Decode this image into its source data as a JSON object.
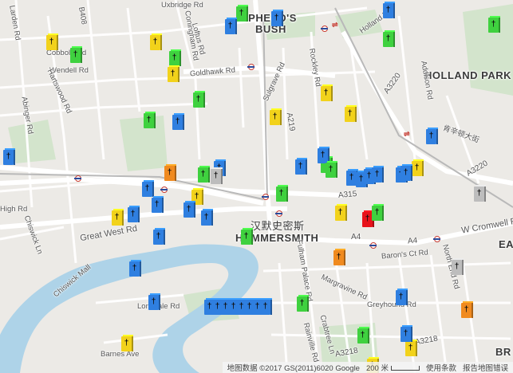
{
  "map": {
    "areas": [
      {
        "text": "EPHERD'S",
        "key": "shep1"
      },
      {
        "text": "BUSH",
        "key": "shep2"
      },
      {
        "text": "HOLLAND PARK",
        "key": "holland"
      },
      {
        "text": "HAMMERSMITH",
        "key": "hammer"
      },
      {
        "text": "汉默史密斯",
        "key": "hammer_cn"
      },
      {
        "text": "EA",
        "key": "ea"
      },
      {
        "text": "BR",
        "key": "br"
      }
    ],
    "roads": [
      {
        "text": "Uxbridge Rd",
        "key": "uxb"
      },
      {
        "text": "B408",
        "key": "b408"
      },
      {
        "text": "Larden Rd",
        "key": "larden"
      },
      {
        "text": "Cobbold Rd",
        "key": "cobbold"
      },
      {
        "text": "Wendell Rd",
        "key": "wendell"
      },
      {
        "text": "Coningham Rd",
        "key": "coningham"
      },
      {
        "text": "Loftus Rd",
        "key": "loftus"
      },
      {
        "text": "Hartswood Rd",
        "key": "hartswood"
      },
      {
        "text": "Abinger Rd",
        "key": "abinger"
      },
      {
        "text": "Goldhawk Rd",
        "key": "goldhawk"
      },
      {
        "text": "Sulgrave Rd",
        "key": "sulgrave"
      },
      {
        "text": "Rockley Rd",
        "key": "rockley"
      },
      {
        "text": "Holland Rd",
        "key": "hollandrd"
      },
      {
        "text": "Addison Rd",
        "key": "addison"
      },
      {
        "text": "A3220",
        "key": "a3220a"
      },
      {
        "text": "A3220",
        "key": "a3220b"
      },
      {
        "text": "A219",
        "key": "a219"
      },
      {
        "text": "肯辛顿大街",
        "key": "kens"
      },
      {
        "text": "High Rd",
        "key": "highrd"
      },
      {
        "text": "Chiswick Ln",
        "key": "chiswickln"
      },
      {
        "text": "Great West Rd",
        "key": "gwr"
      },
      {
        "text": "A315",
        "key": "a315"
      },
      {
        "text": "A4",
        "key": "a4a"
      },
      {
        "text": "A4",
        "key": "a4b"
      },
      {
        "text": "W Cromwell Rd",
        "key": "wcromwell"
      },
      {
        "text": "Fulham Palace Rd",
        "key": "fulham"
      },
      {
        "text": "Baron's Ct Rd",
        "key": "barons"
      },
      {
        "text": "North End Rd",
        "key": "northend"
      },
      {
        "text": "Margravine Rd",
        "key": "margravine"
      },
      {
        "text": "Greyhound Rd",
        "key": "greyhound"
      },
      {
        "text": "Chiswick Mall",
        "key": "chiswickmall"
      },
      {
        "text": "Lonsdale Rd",
        "key": "lonsdale"
      },
      {
        "text": "Barnes Ave",
        "key": "barnes"
      },
      {
        "text": "Rainville Rd",
        "key": "rainville"
      },
      {
        "text": "Crabtree Ln",
        "key": "crabtree"
      },
      {
        "text": "A3218",
        "key": "a3218"
      },
      {
        "text": "A3218",
        "key": "a3218b"
      }
    ],
    "markers": [
      {
        "color": "#2f7fe0"
      },
      {
        "color": "#3fd13f"
      },
      {
        "color": "#f2d21b"
      },
      {
        "color": "#3fd13f"
      },
      {
        "color": "#2f7fe0"
      },
      {
        "color": "#2f7fe0"
      },
      {
        "color": "#3fd13f"
      },
      {
        "color": "#f2d21b"
      },
      {
        "color": "#3fd13f"
      },
      {
        "color": "#f2d21b"
      },
      {
        "color": "#3fd13f"
      },
      {
        "color": "#3fd13f"
      },
      {
        "color": "#f2d21b"
      },
      {
        "color": "#3fd13f"
      },
      {
        "color": "#2f7fe0"
      },
      {
        "color": "#3fd13f"
      },
      {
        "color": "#f2d21b"
      },
      {
        "color": "#f2d21b"
      },
      {
        "color": "#2f7fe0"
      },
      {
        "color": "#2f7fe0"
      },
      {
        "color": "#2f7fe0"
      },
      {
        "color": "#f08a1f"
      },
      {
        "color": "#3fd13f"
      },
      {
        "color": "#2f7fe0"
      },
      {
        "color": "#bdbdbd"
      },
      {
        "color": "#2f7fe0"
      },
      {
        "color": "#f2d21b"
      },
      {
        "color": "#2f7fe0"
      },
      {
        "color": "#2f7fe0"
      },
      {
        "color": "#f2d21b"
      },
      {
        "color": "#2f7fe0"
      },
      {
        "color": "#3fd13f"
      },
      {
        "color": "#2f7fe0"
      },
      {
        "color": "#2f7fe0"
      },
      {
        "color": "#3fd13f"
      },
      {
        "color": "#2f7fe0"
      },
      {
        "color": "#2f7fe0"
      },
      {
        "color": "#2f7fe0"
      },
      {
        "color": "#2f7fe0"
      },
      {
        "color": "#2f7fe0"
      },
      {
        "color": "#f2d21b"
      },
      {
        "color": "#bdbdbd"
      },
      {
        "color": "#f2d21b"
      },
      {
        "color": "#e8121a"
      },
      {
        "color": "#3fd13f"
      },
      {
        "color": "#f08a1f"
      },
      {
        "color": "#bdbdbd"
      },
      {
        "color": "#2f7fe0"
      },
      {
        "color": "#2f7fe0"
      },
      {
        "color": "#2f7fe0"
      },
      {
        "color": "#2f7fe0"
      },
      {
        "color": "#2f7fe0"
      },
      {
        "color": "#2f7fe0"
      },
      {
        "color": "#2f7fe0"
      },
      {
        "color": "#2f7fe0"
      },
      {
        "color": "#2f7fe0"
      },
      {
        "color": "#2f7fe0"
      },
      {
        "color": "#2f7fe0"
      },
      {
        "color": "#2f7fe0"
      },
      {
        "color": "#3fd13f"
      },
      {
        "color": "#2f7fe0"
      },
      {
        "color": "#f08a1f"
      },
      {
        "color": "#3fd13f"
      },
      {
        "color": "#3fd13f"
      },
      {
        "color": "#f2d21b"
      },
      {
        "color": "#f2d21b"
      },
      {
        "color": "#2f7fe0"
      },
      {
        "color": "#f2d21b"
      }
    ],
    "colors": {
      "land": "#eceae6",
      "water": "#aed3e8",
      "park": "#d3e4cc",
      "road": "#ffffff",
      "major_road": "#ffffff"
    }
  },
  "footer": {
    "attribution": "地图数据 ©2017 GS(2011)6020 Google",
    "scale_label": "200 米",
    "terms": "使用条款",
    "report": "报告地图错误"
  }
}
